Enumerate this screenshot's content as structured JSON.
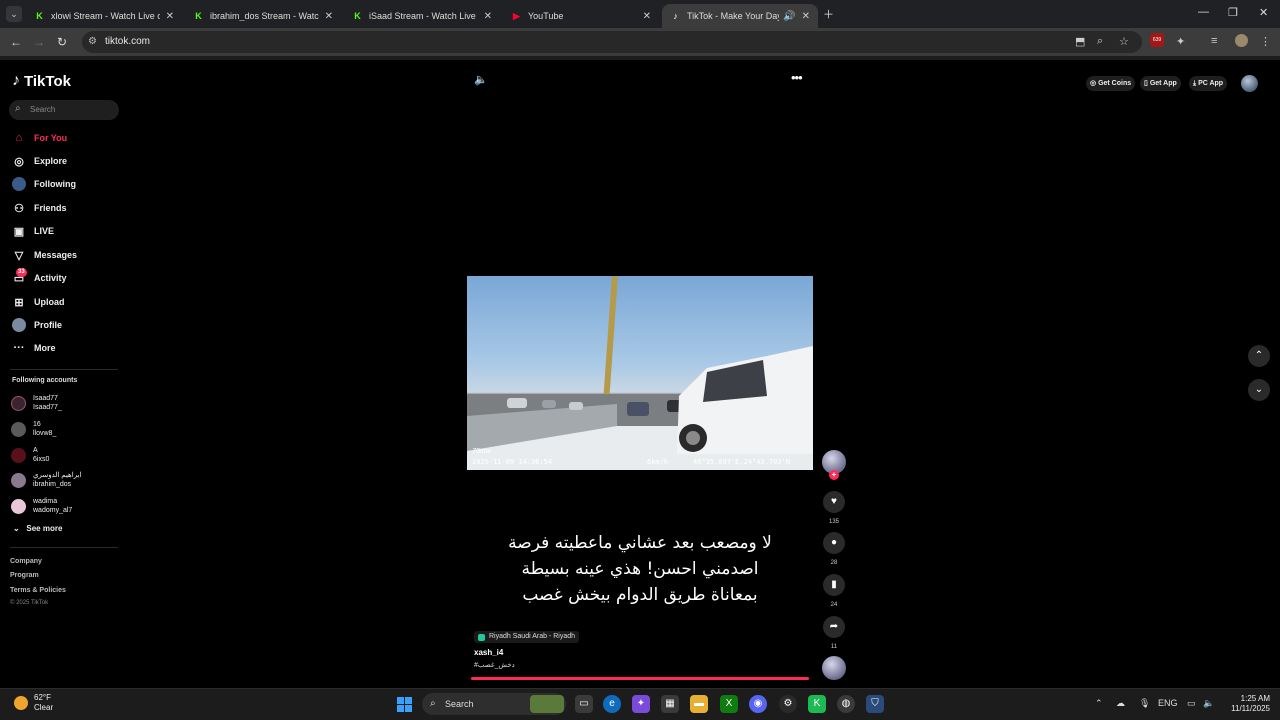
{
  "browser": {
    "tabs": [
      {
        "title": "xlowi Stream - Watch Live on Ki",
        "favicon": "kick-icon"
      },
      {
        "title": "ibrahim_dos Stream - Watch Liv",
        "favicon": "kick-icon"
      },
      {
        "title": "iSaad Stream - Watch Live on Ki",
        "favicon": "kick-icon"
      },
      {
        "title": "YouTube",
        "favicon": "youtube-icon"
      },
      {
        "title": "TikTok - Make Your Day",
        "favicon": "tiktok-icon",
        "active": true
      }
    ],
    "url": "tiktok.com",
    "extension_badge": "639"
  },
  "sidebar": {
    "logo": "TikTok",
    "search_placeholder": "Search",
    "nav": [
      {
        "label": "For You",
        "icon": "home-icon",
        "active": true
      },
      {
        "label": "Explore",
        "icon": "compass-icon"
      },
      {
        "label": "Following",
        "icon": "following-avatar-icon"
      },
      {
        "label": "Friends",
        "icon": "friends-icon"
      },
      {
        "label": "LIVE",
        "icon": "live-icon"
      },
      {
        "label": "Messages",
        "icon": "send-icon"
      },
      {
        "label": "Activity",
        "icon": "activity-icon",
        "badge": "33"
      },
      {
        "label": "Upload",
        "icon": "plus-square-icon"
      },
      {
        "label": "Profile",
        "icon": "profile-avatar-icon"
      },
      {
        "label": "More",
        "icon": "ellipsis-icon"
      }
    ],
    "following_title": "Following accounts",
    "accounts": [
      {
        "display": "Isaad77",
        "handle": "Isaad77_",
        "color": "#3a2430"
      },
      {
        "display": "16",
        "handle": "llovw8_",
        "color": "#5a5a5a"
      },
      {
        "display": "A",
        "handle": "6ixs0",
        "color": "#5a0f1a"
      },
      {
        "display": "ابراهيم الدوسري",
        "handle": "ibrahim_dos",
        "color": "#8a7a90"
      },
      {
        "display": "wadima",
        "handle": "wadomy_al7",
        "color": "#e8c8d8"
      }
    ],
    "see_more": "See more",
    "footer": [
      "Company",
      "Program",
      "Terms & Policies"
    ],
    "copyright": "© 2025 TikTok"
  },
  "header_actions": [
    {
      "label": "Get Coins",
      "icon": "coin-icon"
    },
    {
      "label": "Get App",
      "icon": "phone-icon"
    },
    {
      "label": "PC App",
      "icon": "download-icon"
    }
  ],
  "video": {
    "overlay_brand": "70mai",
    "timestamp": "2025-11-09 14:36:54",
    "speed": "6km/h",
    "coords": "46°35.897'E,24°43.703'N",
    "caption_lines": [
      "لا ومصعب بعد عشاني ماعطيته فرصة",
      "اصدمني احسن! هذي عينه بسيطة",
      "بمعاناة طريق الدوام بيخش غصب"
    ],
    "location": "Riyadh Saudi Arab - Riyadh",
    "author": "xash_i4",
    "hashtag": "#دخش_غصب",
    "progress": 1.0
  },
  "actions": {
    "likes": "135",
    "comments": "28",
    "saves": "24",
    "shares": "11"
  },
  "taskbar": {
    "temp": "62°F",
    "condition": "Clear",
    "search_label": "Search",
    "lang": "ENG",
    "time": "1:25 AM",
    "date": "11/11/2025"
  }
}
